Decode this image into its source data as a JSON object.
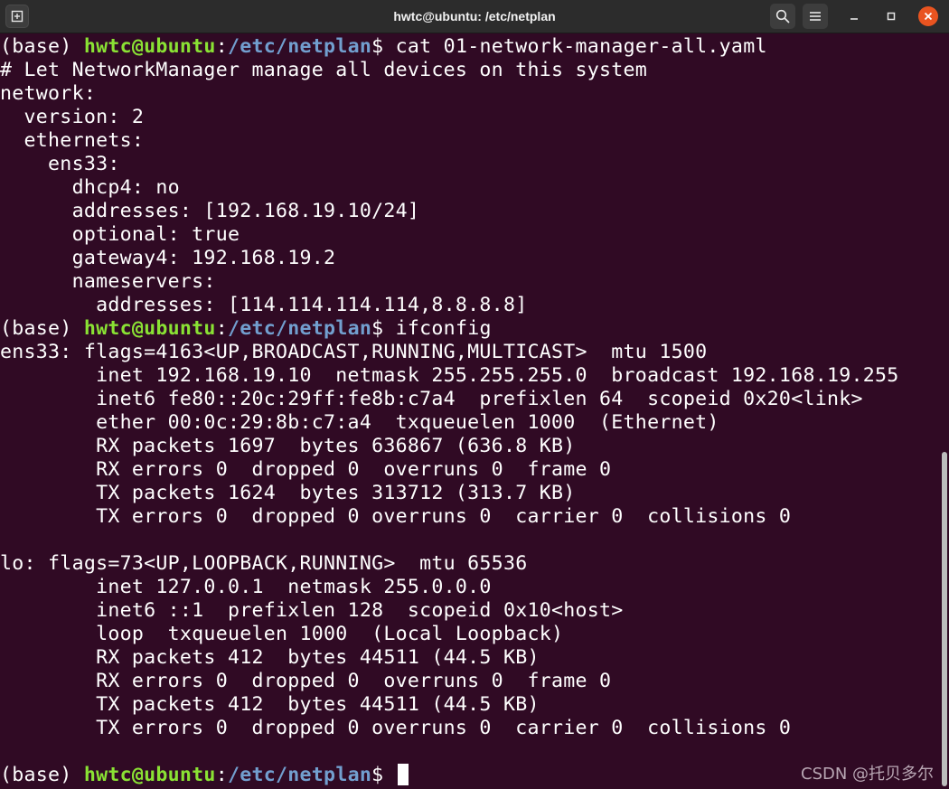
{
  "window": {
    "title": "hwtc@ubuntu: /etc/netplan",
    "icons": {
      "new_tab": "new-tab-icon",
      "search": "search-icon",
      "menu": "hamburger-menu-icon",
      "minimize": "minimize-icon",
      "maximize": "maximize-icon",
      "close": "close-icon"
    },
    "close_color": "#e95420"
  },
  "colors": {
    "background": "#300a24",
    "text": "#ffffff",
    "prompt_user": "#8ae234",
    "prompt_path": "#729fcf"
  },
  "prompts": [
    {
      "env": "(base) ",
      "user": "hwtc@ubuntu",
      "sep": ":",
      "path": "/etc/netplan",
      "symbol": "$ ",
      "command": "cat 01-network-manager-all.yaml"
    },
    {
      "env": "(base) ",
      "user": "hwtc@ubuntu",
      "sep": ":",
      "path": "/etc/netplan",
      "symbol": "$ ",
      "command": "ifconfig"
    },
    {
      "env": "(base) ",
      "user": "hwtc@ubuntu",
      "sep": ":",
      "path": "/etc/netplan",
      "symbol": "$ ",
      "command": ""
    }
  ],
  "yaml_output": [
    "# Let NetworkManager manage all devices on this system",
    "network:",
    "  version: 2",
    "  ethernets:",
    "    ens33:",
    "      dhcp4: no",
    "      addresses: [192.168.19.10/24]",
    "      optional: true",
    "      gateway4: 192.168.19.2",
    "      nameservers:",
    "        addresses: [114.114.114.114,8.8.8.8]"
  ],
  "ifconfig_output": [
    "ens33: flags=4163<UP,BROADCAST,RUNNING,MULTICAST>  mtu 1500",
    "        inet 192.168.19.10  netmask 255.255.255.0  broadcast 192.168.19.255",
    "        inet6 fe80::20c:29ff:fe8b:c7a4  prefixlen 64  scopeid 0x20<link>",
    "        ether 00:0c:29:8b:c7:a4  txqueuelen 1000  (Ethernet)",
    "        RX packets 1697  bytes 636867 (636.8 KB)",
    "        RX errors 0  dropped 0  overruns 0  frame 0",
    "        TX packets 1624  bytes 313712 (313.7 KB)",
    "        TX errors 0  dropped 0 overruns 0  carrier 0  collisions 0",
    "",
    "lo: flags=73<UP,LOOPBACK,RUNNING>  mtu 65536",
    "        inet 127.0.0.1  netmask 255.0.0.0",
    "        inet6 ::1  prefixlen 128  scopeid 0x10<host>",
    "        loop  txqueuelen 1000  (Local Loopback)",
    "        RX packets 412  bytes 44511 (44.5 KB)",
    "        RX errors 0  dropped 0  overruns 0  frame 0",
    "        TX packets 412  bytes 44511 (44.5 KB)",
    "        TX errors 0  dropped 0 overruns 0  carrier 0  collisions 0",
    ""
  ],
  "watermark": "CSDN @托贝多尔"
}
